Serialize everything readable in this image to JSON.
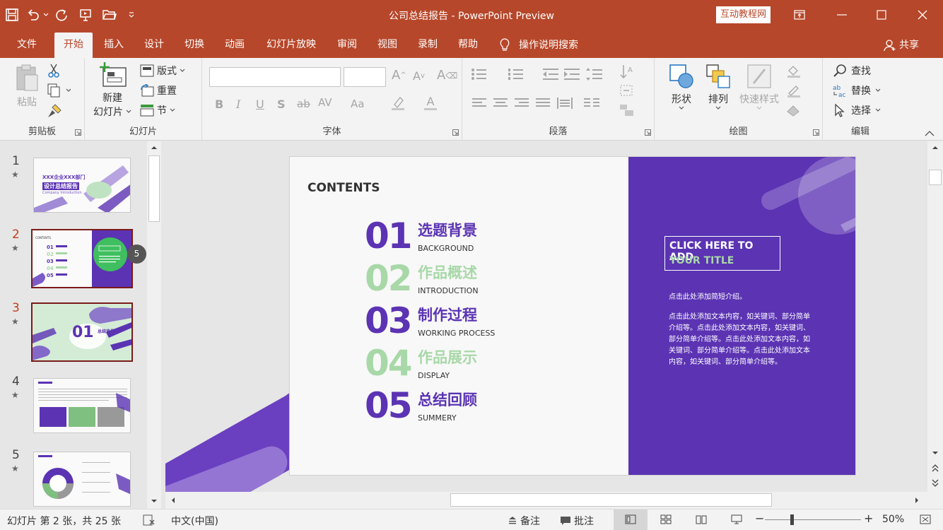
{
  "window": {
    "title": "公司总结报告 - PowerPoint Preview",
    "promo_label": "互动教程网",
    "share_label": "共享"
  },
  "tabs": [
    "文件",
    "开始",
    "插入",
    "设计",
    "切换",
    "动画",
    "幻灯片放映",
    "审阅",
    "视图",
    "录制",
    "帮助"
  ],
  "search_tab": "操作说明搜索",
  "ribbon": {
    "clipboard": {
      "label": "剪贴板",
      "paste": "粘贴"
    },
    "slides": {
      "label": "幻灯片",
      "new_slide_1": "新建",
      "new_slide_2": "幻灯片",
      "layout": "版式",
      "reset": "重置",
      "section": "节"
    },
    "font": {
      "label": "字体"
    },
    "paragraph": {
      "label": "段落"
    },
    "drawing": {
      "label": "绘图",
      "shape": "形状",
      "arrange": "排列",
      "quick_styles": "快速样式"
    },
    "editing": {
      "label": "编辑",
      "find": "查找",
      "replace": "替换",
      "select": "选择"
    }
  },
  "thumbnails": [
    {
      "num": "1",
      "star": "★",
      "title1": "XXX企业XXX部门",
      "title2": "设计总结报告",
      "sub": "Company Introduction"
    },
    {
      "num": "2",
      "star": "★",
      "badge": "5"
    },
    {
      "num": "3",
      "star": "★",
      "big": "01",
      "small": "总结背景"
    },
    {
      "num": "4",
      "star": "★"
    },
    {
      "num": "5",
      "star": "★"
    }
  ],
  "slide": {
    "heading": "CONTENTS",
    "items": [
      {
        "num": "01",
        "zh": "选题背景",
        "en": "BACKGROUND"
      },
      {
        "num": "02",
        "zh": "作品概述",
        "en": "INTRODUCTION"
      },
      {
        "num": "03",
        "zh": "制作过程",
        "en": "WORKING PROCESS"
      },
      {
        "num": "04",
        "zh": "作品展示",
        "en": "DISPLAY"
      },
      {
        "num": "05",
        "zh": "总结回顾",
        "en": "SUMMERY"
      }
    ],
    "title_box": {
      "line1": "CLICK HERE TO ADD",
      "line2": "YOUR TITLE"
    },
    "intro": "点击此处添加简短介绍。",
    "body_lines": [
      "点击此处添加文本内容，如关键词、部分简单",
      "介绍等。点击此处添加文本内容，如关键词、",
      "部分简单介绍等。点击此处添加文本内容，如",
      "关键词、部分简单介绍等。点击此处添加文本",
      "内容，如关键词、部分简单介绍等。"
    ]
  },
  "status": {
    "slide_info": "幻灯片 第 2 张，共 25 张",
    "language": "中文(中国)",
    "notes": "备注",
    "comments": "批注",
    "zoom": "50%",
    "minus": "−",
    "plus": "+"
  },
  "colors": {
    "brand": "#b7472a",
    "purple": "#5b33b3",
    "green": "#a8d8a8"
  }
}
